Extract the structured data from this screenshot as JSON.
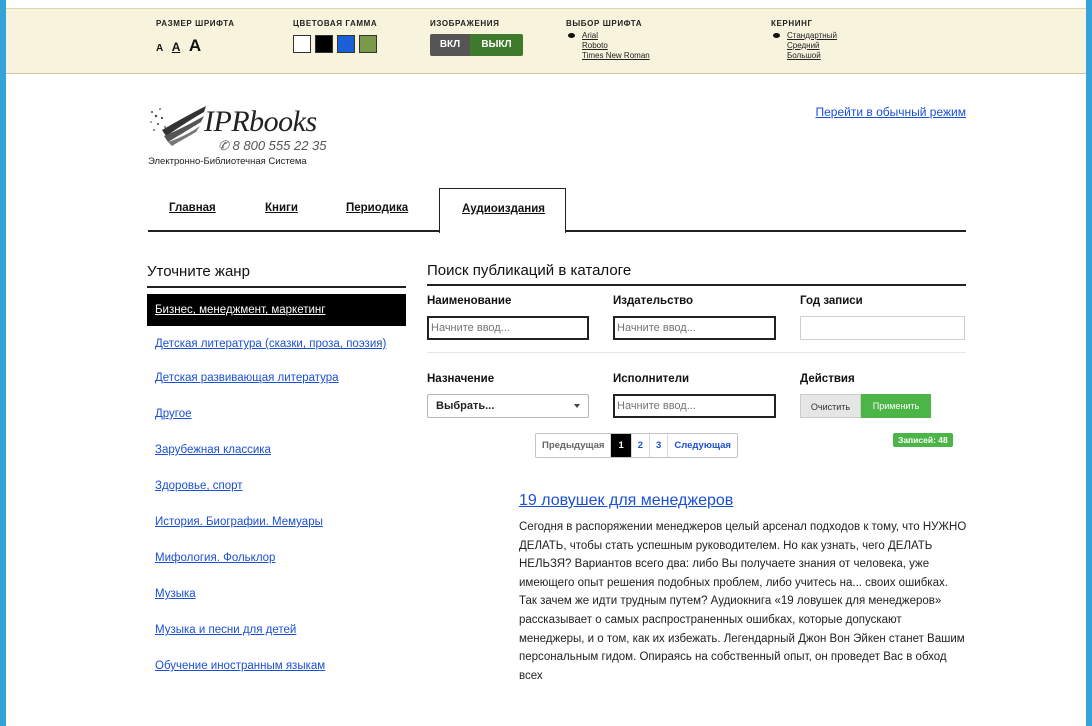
{
  "accessibility": {
    "font_size": {
      "title": "РАЗМЕР ШРИФТА",
      "small": "A",
      "medium": "A",
      "large": "A"
    },
    "color_scheme": {
      "title": "ЦВЕТОВАЯ ГАММА",
      "swatches": [
        "#ffffff",
        "#000000",
        "#1a5fd6",
        "#7a9a4a"
      ]
    },
    "images": {
      "title": "ИЗОБРАЖЕНИЯ",
      "on_label": "ВКЛ",
      "off_label": "ВЫКЛ"
    },
    "font_choice": {
      "title": "ВЫБОР ШРИФТА",
      "options": [
        "Arial",
        "Roboto",
        "Times New Roman"
      ],
      "selected": "Arial"
    },
    "kerning": {
      "title": "КЕРНИНГ",
      "options": [
        "Стандартный",
        "Средний",
        "Большой"
      ],
      "selected": "Стандартный"
    }
  },
  "header": {
    "logo_brand": "IPRbooks",
    "logo_phone": "8 800 555 22 35",
    "logo_tagline": "Электронно-Библиотечная Система",
    "normal_mode_link": "Перейти в обычный режим"
  },
  "tabs": [
    {
      "label": "Главная",
      "active": false
    },
    {
      "label": "Книги",
      "active": false
    },
    {
      "label": "Периодика",
      "active": false
    },
    {
      "label": "Аудиоиздания",
      "active": true
    }
  ],
  "genres": {
    "title": "Уточните жанр",
    "items": [
      "Бизнес, менеджмент, маркетинг",
      "Детская литература (сказки, проза, поэзия)",
      "Детская развивающая литература",
      "Другое",
      "Зарубежная классика",
      "Здоровье, спорт",
      "История. Биографии. Мемуары",
      "Мифология. Фольклор",
      "Музыка",
      "Музыка и песни для детей",
      "Обучение иностранным языкам"
    ],
    "active_index": 0
  },
  "search": {
    "title": "Поиск публикаций в каталоге",
    "name_label": "Наименование",
    "name_placeholder": "Начните ввод...",
    "publisher_label": "Издательство",
    "publisher_placeholder": "Начните ввод...",
    "year_label": "Год записи",
    "purpose_label": "Назначение",
    "purpose_value": "Выбрать...",
    "performers_label": "Исполнители",
    "performers_placeholder": "Начните ввод...",
    "actions_label": "Действия",
    "clear_button": "Очистить",
    "apply_button": "Применить"
  },
  "pagination": {
    "prev": "Предыдущая",
    "pages": [
      "1",
      "2",
      "3"
    ],
    "current": "1",
    "next": "Следующая",
    "records_badge": "Записей: 48"
  },
  "result": {
    "title": "19 ловушек для менеджеров",
    "description": "Сегодня в распоряжении менеджеров целый арсенал подходов к тому, что НУЖНО ДЕЛАТЬ, чтобы стать успешным руководителем. Но как узнать, чего ДЕЛАТЬ НЕЛЬЗЯ? Вариантов всего два: либо Вы получаете знания от человека, уже имеющего опыт решения подобных проблем, либо учитесь на... своих ошибках. Так зачем же идти трудным путем? Аудиокнига «19 ловушек для менеджеров» рассказывает о самых распространенных ошибках, которые допускают менеджеры, и о том, как их избежать. Легендарный Джон Вон Эйкен станет Вашим персональным гидом. Опираясь на собственный опыт, он проведет Вас в обход всех"
  }
}
